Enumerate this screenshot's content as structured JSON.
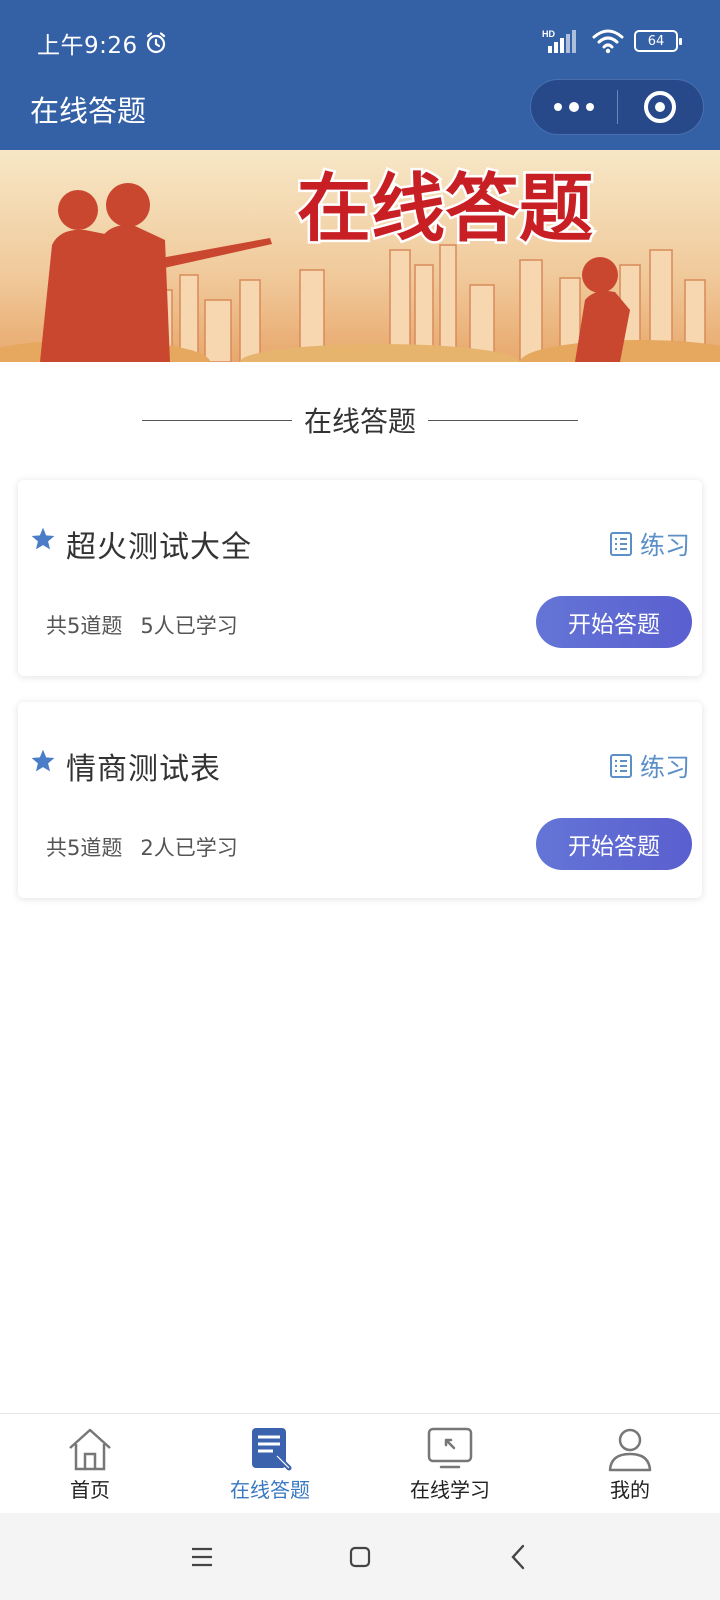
{
  "status_bar": {
    "time": "上午9:26",
    "network": "HD",
    "battery": "64"
  },
  "nav": {
    "title": "在线答题"
  },
  "banner": {
    "text": "在线答题",
    "colors": {
      "text": "#c81f24",
      "sky": "#f0d4a8",
      "silhouette": "#c9472e"
    }
  },
  "section": {
    "title": "在线答题"
  },
  "quizzes": [
    {
      "title": "超火测试大全",
      "practice_label": "练习",
      "question_count": "共5道题",
      "learners": "5人已学习",
      "start_label": "开始答题"
    },
    {
      "title": "情商测试表",
      "practice_label": "练习",
      "question_count": "共5道题",
      "learners": "2人已学习",
      "start_label": "开始答题"
    }
  ],
  "tabbar": {
    "items": [
      {
        "label": "首页",
        "icon": "home-icon",
        "active": false
      },
      {
        "label": "在线答题",
        "icon": "quiz-icon",
        "active": true
      },
      {
        "label": "在线学习",
        "icon": "study-icon",
        "active": false
      },
      {
        "label": "我的",
        "icon": "profile-icon",
        "active": false
      }
    ]
  },
  "theme": {
    "primary": "#3460a6",
    "accent": "#5a8fc8",
    "button": "#6070d5",
    "active_tab": "#3a78c2"
  }
}
